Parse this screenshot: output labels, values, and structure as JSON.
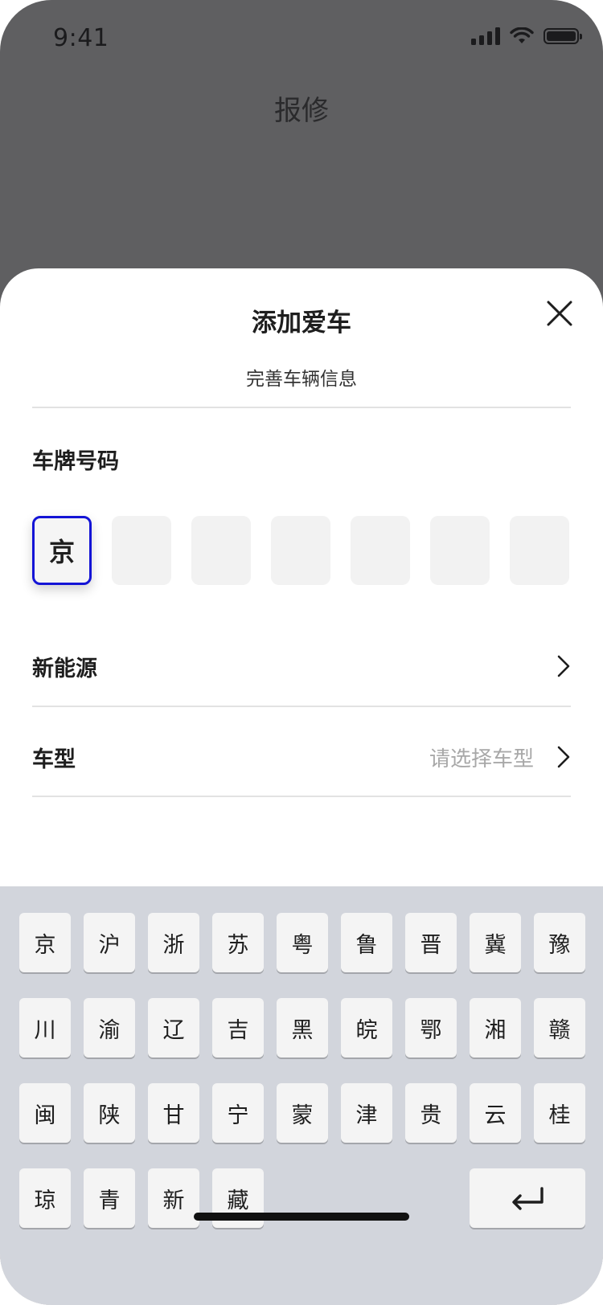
{
  "status_bar": {
    "time": "9:41",
    "icons": [
      "signal-icon",
      "wifi-icon",
      "battery-icon"
    ]
  },
  "background": {
    "title": "报修"
  },
  "sheet": {
    "title": "添加爱车",
    "subtitle": "完善车辆信息",
    "close_icon": "close-icon",
    "plate": {
      "label": "车牌号码",
      "cells": [
        "京",
        "",
        "",
        "",
        "",
        "",
        ""
      ]
    },
    "new_energy": {
      "label": "新能源"
    },
    "car_model": {
      "label": "车型",
      "placeholder": "请选择车型"
    }
  },
  "keyboard": {
    "rows": [
      [
        "京",
        "沪",
        "浙",
        "苏",
        "粤",
        "鲁",
        "晋",
        "冀",
        "豫"
      ],
      [
        "川",
        "渝",
        "辽",
        "吉",
        "黑",
        "皖",
        "鄂",
        "湘",
        "赣"
      ],
      [
        "闽",
        "陕",
        "甘",
        "宁",
        "蒙",
        "津",
        "贵",
        "云",
        "桂"
      ],
      [
        "琼",
        "青",
        "新",
        "藏"
      ]
    ],
    "enter_icon": "return-icon"
  },
  "colors": {
    "accent": "#1414d6",
    "overlay": "#5f5f61",
    "keyboard_bg": "#d2d5dc",
    "placeholder": "#a8a8a8"
  }
}
